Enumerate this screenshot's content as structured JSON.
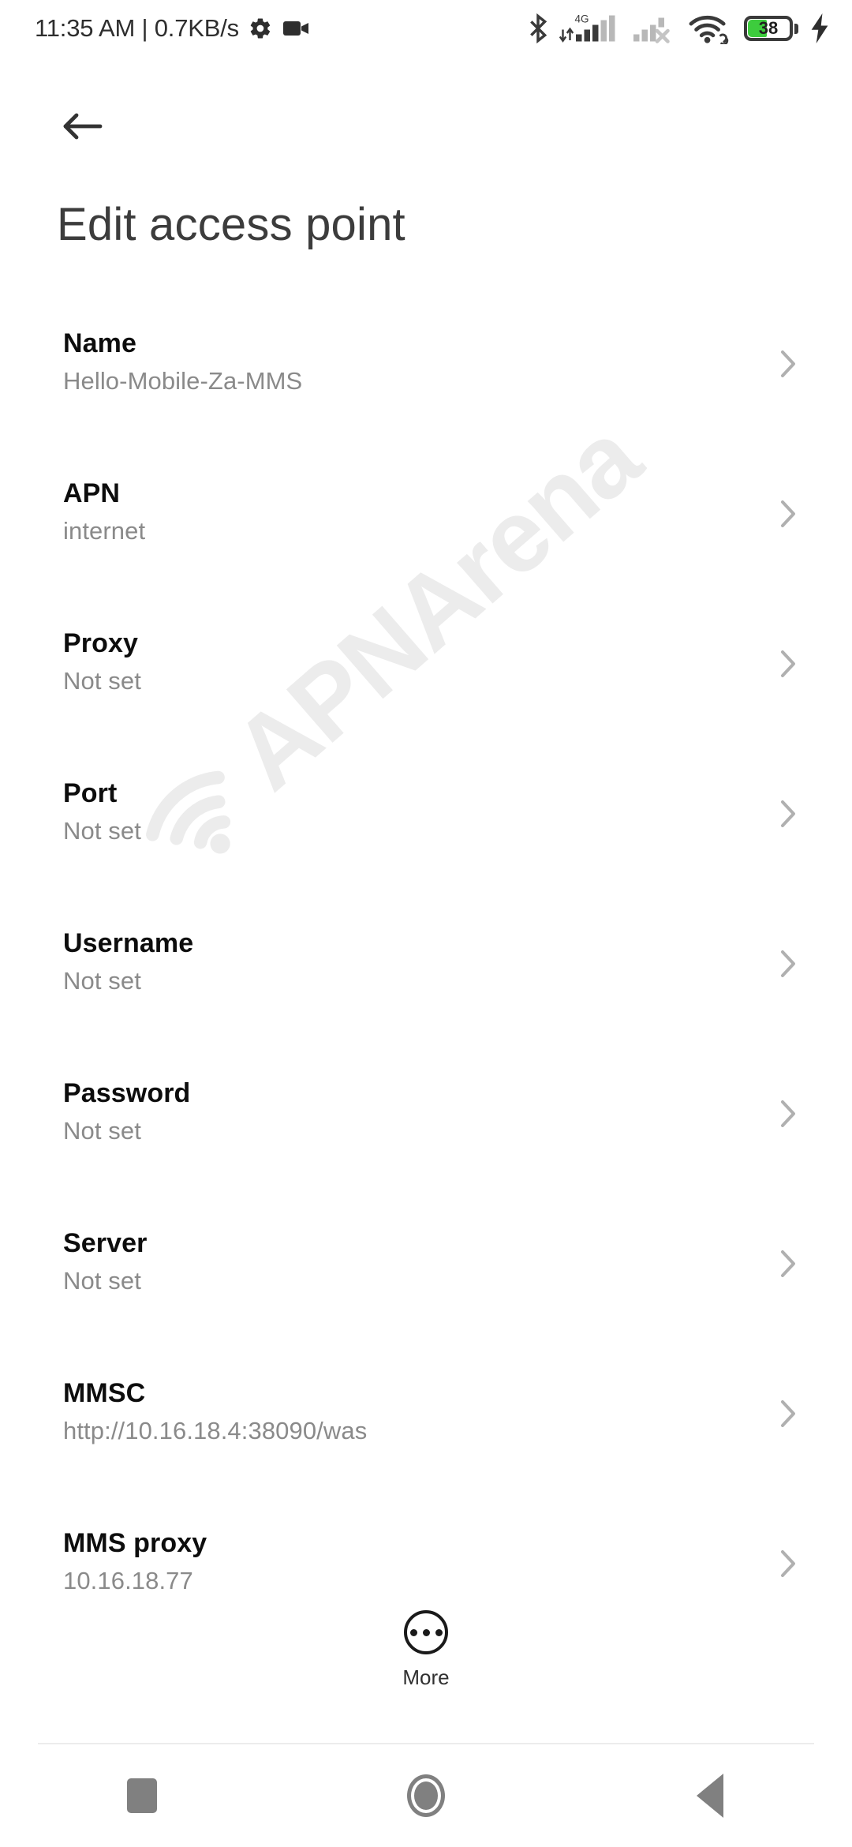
{
  "statusbar": {
    "clock": "11:35 AM | 0.7KB/s",
    "gear_icon": "gear-icon",
    "camera_icon": "video-camera-icon",
    "bluetooth_icon": "bluetooth-icon",
    "network_type": "4G",
    "sim1_signal_icon": "signal-bars-sim1-icon",
    "sim2_signal_icon": "signal-bars-sim2-no-service-icon",
    "wifi_icon": "wifi-icon",
    "wifi_link_icon": "wifi-link-icon",
    "battery_percent": "38",
    "battery_color": "#3dcc3d",
    "charging_icon": "charging-bolt-icon"
  },
  "header": {
    "back_icon": "back-arrow-icon",
    "title": "Edit access point"
  },
  "watermark": {
    "text": "APNArena",
    "icon": "wifi-signal-icon",
    "color": "#ececec"
  },
  "list": {
    "chevron_icon": "chevron-right-icon",
    "rows": [
      {
        "label": "Name",
        "value": "Hello-Mobile-Za-MMS"
      },
      {
        "label": "APN",
        "value": "internet"
      },
      {
        "label": "Proxy",
        "value": "Not set"
      },
      {
        "label": "Port",
        "value": "Not set"
      },
      {
        "label": "Username",
        "value": "Not set"
      },
      {
        "label": "Password",
        "value": "Not set"
      },
      {
        "label": "Server",
        "value": "Not set"
      },
      {
        "label": "MMSC",
        "value": "http://10.16.18.4:38090/was"
      },
      {
        "label": "MMS proxy",
        "value": "10.16.18.77"
      }
    ]
  },
  "more": {
    "label": "More",
    "icon": "more-dots-circle-icon"
  },
  "navbar": {
    "recents_icon": "recents-square-icon",
    "home_icon": "home-circle-icon",
    "back_icon": "back-triangle-icon"
  }
}
